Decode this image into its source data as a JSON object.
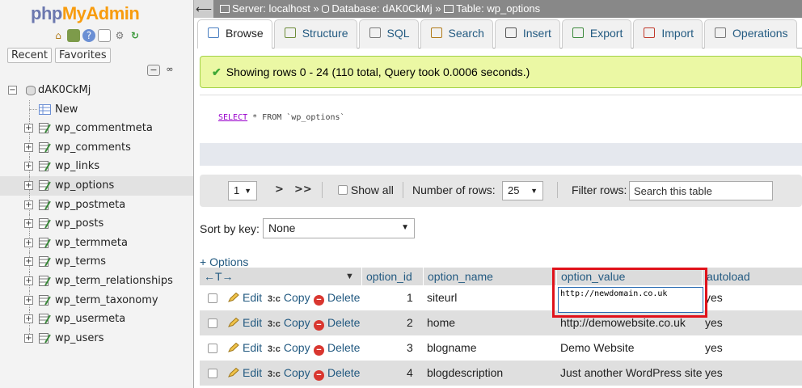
{
  "logo": {
    "part1": "php",
    "part2": "MyAdmin"
  },
  "nav": {
    "tabs": [
      "Recent",
      "Favorites"
    ],
    "database": "dAK0CkMj",
    "new_label": "New",
    "tables": [
      "wp_commentmeta",
      "wp_comments",
      "wp_links",
      "wp_options",
      "wp_postmeta",
      "wp_posts",
      "wp_termmeta",
      "wp_terms",
      "wp_term_relationships",
      "wp_term_taxonomy",
      "wp_usermeta",
      "wp_users"
    ],
    "selected_table": "wp_options"
  },
  "breadcrumb": {
    "server": "Server: localhost",
    "database": "Database: dAK0CkMj",
    "table": "Table: wp_options",
    "separator": "»"
  },
  "tabs": [
    "Browse",
    "Structure",
    "SQL",
    "Search",
    "Insert",
    "Export",
    "Import",
    "Operations"
  ],
  "active_tab": "Browse",
  "success_message": "Showing rows 0 - 24 (110 total, Query took 0.0006 seconds.)",
  "sql": {
    "keyword": "SELECT",
    "rest": " * FROM `wp_options`"
  },
  "pager": {
    "page": "1",
    "next": ">",
    "last": ">>",
    "show_all": "Show all",
    "rows_label": "Number of rows:",
    "rows_value": "25",
    "filter_label": "Filter rows:",
    "filter_placeholder": "Search this table"
  },
  "sort": {
    "label": "Sort by key:",
    "value": "None"
  },
  "options_link": "+ Options",
  "table": {
    "headers": [
      "option_id",
      "option_name",
      "option_value",
      "autoload"
    ],
    "actions": {
      "edit": "Edit",
      "copy": "Copy",
      "delete": "Delete"
    },
    "rows": [
      {
        "id": "1",
        "name": "siteurl",
        "value": "http://newdomain.co.uk",
        "autoload": "yes"
      },
      {
        "id": "2",
        "name": "home",
        "value": "http://demowebsite.co.uk",
        "autoload": "yes"
      },
      {
        "id": "3",
        "name": "blogname",
        "value": "Demo Website",
        "autoload": "yes"
      },
      {
        "id": "4",
        "name": "blogdescription",
        "value": "Just another WordPress site",
        "autoload": "yes"
      }
    ]
  },
  "colors": {
    "link": "#235a81",
    "logo_blue": "#6c78af",
    "logo_orange": "#f89c0e",
    "success_bg": "#ebf8a4",
    "highlight": "#e0121b"
  }
}
